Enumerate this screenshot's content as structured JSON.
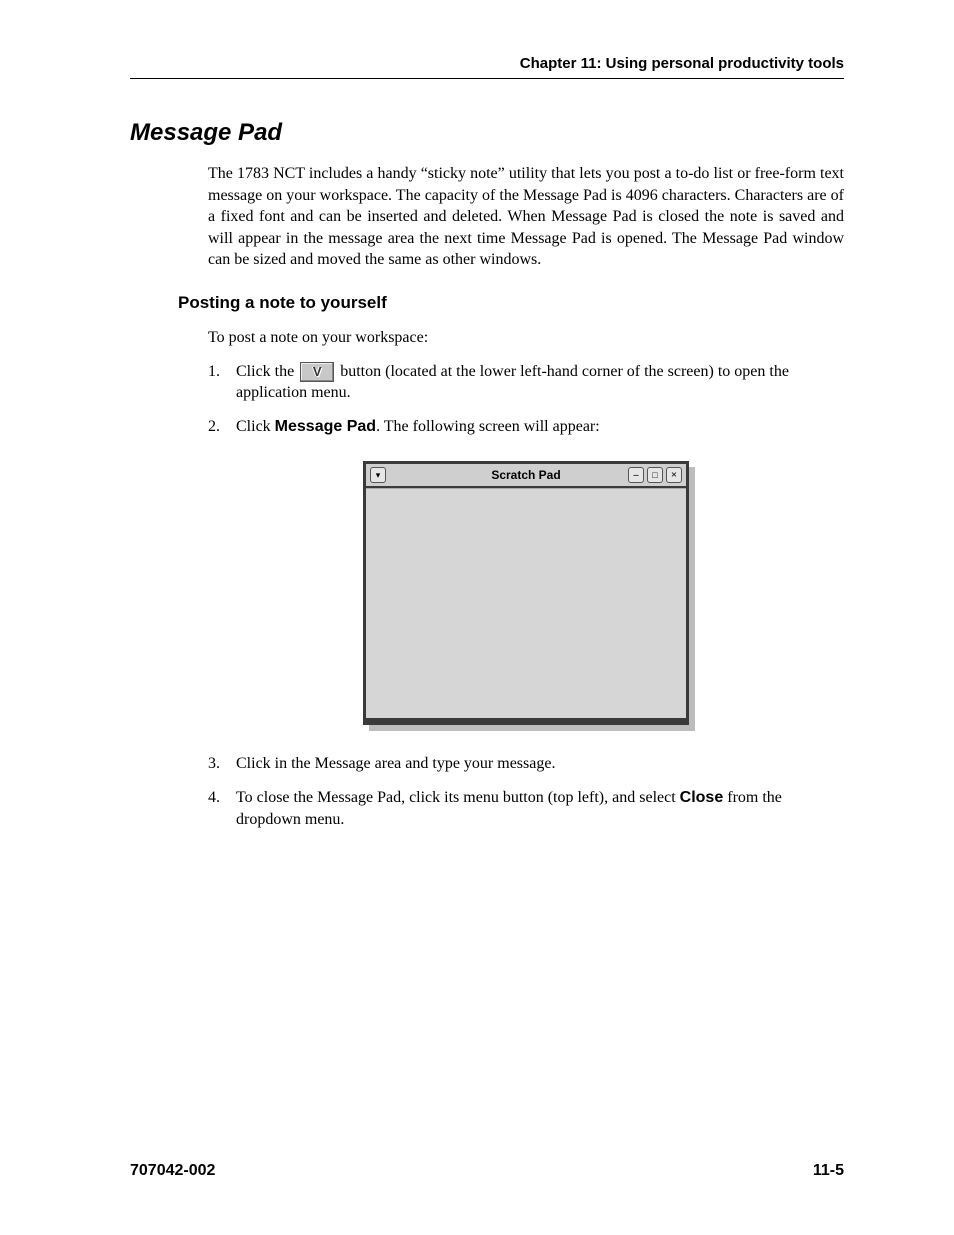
{
  "header": {
    "chapter_line": "Chapter 11: Using personal productivity tools"
  },
  "section": {
    "title": "Message Pad",
    "intro": "The 1783 NCT includes a handy “sticky note” utility that lets you post a to-do list or free-form text message on your workspace. The capacity of the Message Pad is 4096 characters. Characters are of a fixed font and can be inserted and deleted. When Message Pad is closed the note is saved and will appear in the message area the next time Message Pad is opened. The Message Pad window can be sized and moved the same as other windows."
  },
  "subsection": {
    "heading": "Posting a note to yourself",
    "lead": "To post a note on your workspace:",
    "steps": {
      "s1_num": "1.",
      "s1_a": "Click the",
      "s1_b": "button (located at the lower left-hand corner of the screen) to open the application menu.",
      "s2_num": "2.",
      "s2_a": "Click",
      "s2_bold": "Message Pad",
      "s2_b": ". The following screen will appear:",
      "s3_num": "3.",
      "s3": "Click in the Message area and type your message.",
      "s4_num": "4.",
      "s4_a": "To close the Message Pad, click its menu button (top left), and select",
      "s4_bold": "Close",
      "s4_b": "from the dropdown menu."
    }
  },
  "figure": {
    "window_title": "Scratch Pad",
    "menu_glyph": "▾"
  },
  "footer": {
    "doc_number": "707042-002",
    "page_number": "11-5"
  }
}
